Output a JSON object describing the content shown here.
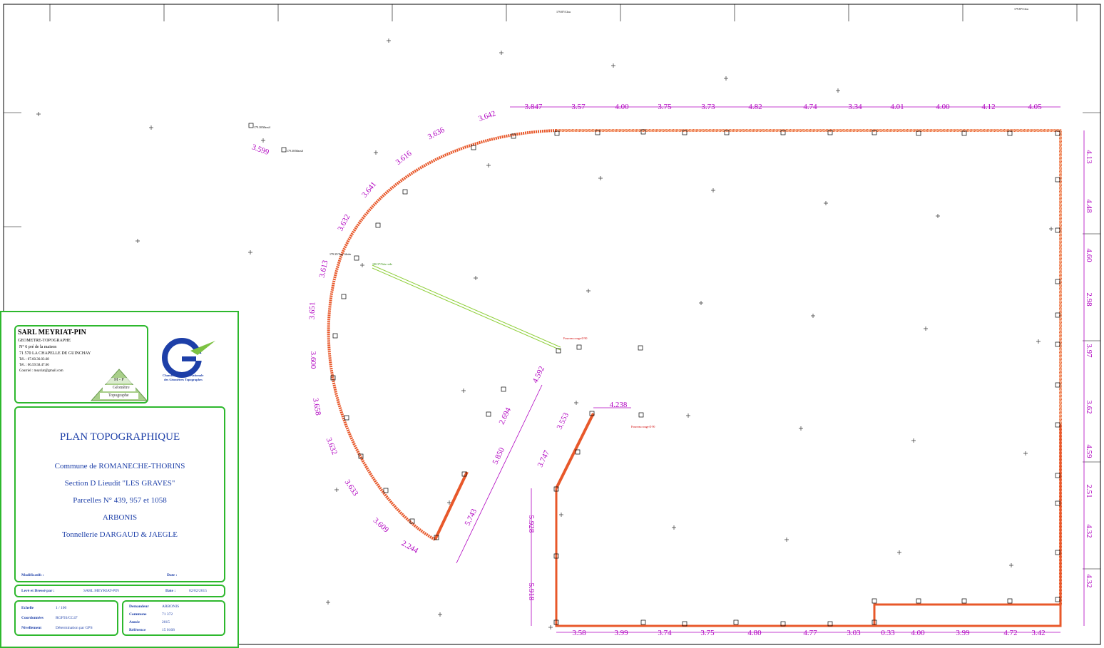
{
  "plan": {
    "top_dimensions": [
      "3.847",
      "3.57",
      "4.00",
      "3.75",
      "3.73",
      "4.82",
      "4.74",
      "3.34",
      "4.01",
      "4.00",
      "4.12",
      "4.05"
    ],
    "right_dimensions": [
      "4.13",
      "4.48",
      "4.60",
      "2.98",
      "3.97",
      "3.62",
      "4.59",
      "2.51",
      "4.32",
      "4.32"
    ],
    "bottom_dimensions": [
      "3.58",
      "3.99",
      "3.74",
      "3.75",
      "4.80",
      "4.77",
      "3.03",
      "0.33",
      "4.00",
      "3.99",
      "4.72",
      "3.42"
    ],
    "arc_dimensions": [
      "3.642",
      "3.636",
      "3.616",
      "3.641",
      "3.632",
      "3.613",
      "3.651",
      "3.600",
      "3.658",
      "3.632",
      "3.633",
      "3.609",
      "2.244"
    ],
    "inner_dimensions": [
      "4.592",
      "2.694",
      "5.850",
      "5.743",
      "4.238",
      "3.553",
      "3.747",
      "5.928",
      "5.918"
    ],
    "isolated_dimension": "3.599",
    "small_labels": {
      "massif": "179.30/Massif",
      "tige": "179.35/Tige filetée",
      "tube_vide": "180.37/Tube vide",
      "fourreau": "Fourreau rouge Ø 90",
      "clou": "179.87/Clou"
    }
  },
  "company": {
    "name": "SARL MEYRIAT-PIN",
    "profession": "GEOMETRE-TOPOGRAPHE",
    "address1": "N° 6 pré de la maison",
    "address2": "71 570 LA CHAPELLE DE GUINCHAY",
    "tel1": "Tél. : 07.60.36.03.68",
    "tel2": "Tél. : 06.59.58.47.66",
    "email": "Courriel : meyriat@gmail.com",
    "badge_top": "M - P",
    "badge_mid": "Géomètre",
    "badge_bottom": "Topographe",
    "logo_caption1": "Chambre Syndicale Nationale",
    "logo_caption2": "des Géomètres Topographes"
  },
  "title": {
    "main": "PLAN TOPOGRAPHIQUE",
    "commune": "Commune de ROMANECHE-THORINS",
    "section": "Section D Lieudit \"LES GRAVES\"",
    "parcelles": "Parcelles N° 439, 957 et 1058",
    "client": "ARBONIS",
    "project": "Tonnellerie DARGAUD & JAEGLE",
    "modifs_label": "Modificatifs :",
    "date_label": "Date :"
  },
  "survey": {
    "label": "Levé et Dressé par :",
    "value": "SARL MEYRIAT-PIN",
    "date_label": "Date :",
    "date_value": "02/02/2015"
  },
  "scale": {
    "echelle_label": "Echelle",
    "echelle_value": "1 / 100",
    "coord_label": "Coordonnées",
    "coord_value": "RGF93/CC47",
    "nivel_label": "Nivellement",
    "nivel_value": "Détermination par GPS"
  },
  "client_info": {
    "demandeur_label": "Demandeur",
    "demandeur_value": "ARBONIS",
    "commune_label": "Commune",
    "commune_value": "71 372",
    "annee_label": "Année",
    "annee_value": "2015",
    "reference_label": "Référence",
    "reference_value": "15 0168"
  },
  "colors": {
    "wall": "#f07a3c",
    "dimension": "#b000c0",
    "frame": "#2db82d",
    "title_text": "#1d3fa8",
    "pipe": "#8fcf3a"
  }
}
